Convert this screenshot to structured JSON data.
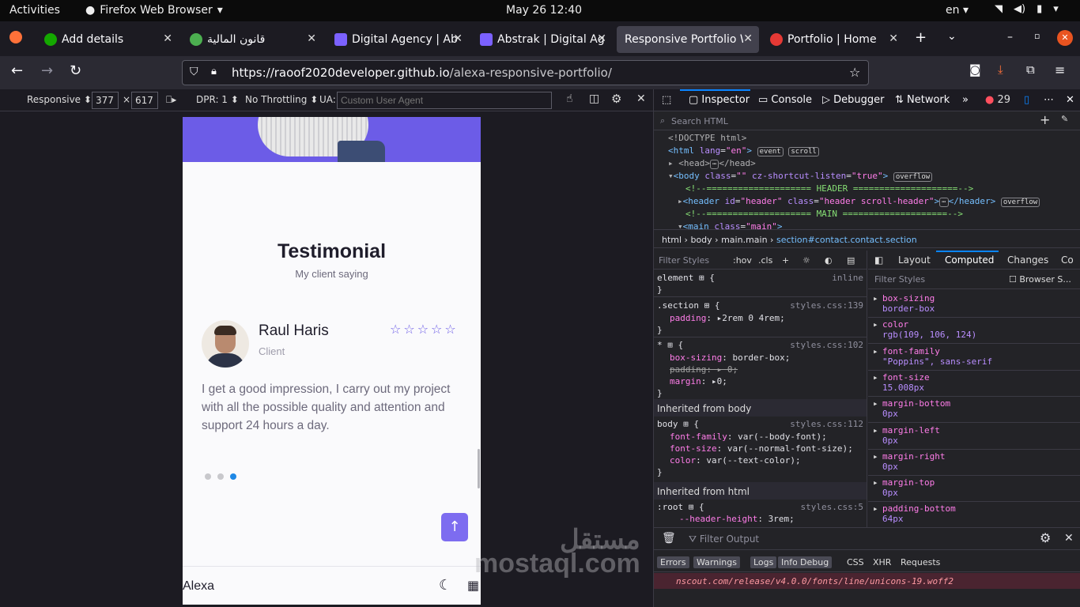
{
  "system": {
    "activities": "Activities",
    "app": "Firefox Web Browser",
    "clock": "May 26  12:40",
    "lang": "en"
  },
  "tabs": [
    {
      "title": "Add details",
      "color": "#14a800"
    },
    {
      "title": "قانون المالية",
      "color": "#4caf50"
    },
    {
      "title": "Digital Agency | Ab",
      "color": "#7b61ff"
    },
    {
      "title": "Abstrak | Digital Ag",
      "color": "#7b61ff"
    },
    {
      "title": "Responsive Portfolio W",
      "color": "#42414d"
    },
    {
      "title": "Portfolio | Home",
      "color": "#e53935"
    }
  ],
  "url": {
    "host": "https://raoof2020developer.github.io",
    "path": "/alexa-responsive-portfolio/"
  },
  "rdm": {
    "device": "Responsive",
    "width": "377",
    "height": "617",
    "dpr": "DPR: 1",
    "throttle": "No Throttling",
    "ua_label": "UA:",
    "ua_placeholder": "Custom User Agent"
  },
  "page": {
    "title": "Testimonial",
    "subtitle": "My client saying",
    "name": "Raul Haris",
    "role": "Client",
    "stars": "☆☆☆☆☆",
    "quote": "I get a good impression, I carry out my project with all the possible quality and attention and support 24 hours a day.",
    "logo": "Alexa"
  },
  "devtools": {
    "tabs": [
      "Inspector",
      "Console",
      "Debugger",
      "Network"
    ],
    "errors": "29",
    "search": "Search HTML",
    "breadcrumb": [
      "html",
      "body",
      "main.main",
      "section#contact.contact.section"
    ],
    "filter_styles": "Filter Styles",
    "hov": ":hov",
    "cls": ".cls",
    "comp_tabs": [
      "Layout",
      "Computed",
      "Changes",
      "Co"
    ],
    "browser_styles": "Browser S...",
    "inherited_body": "Inherited from body",
    "inherited_html": "Inherited from html",
    "computed": [
      {
        "name": "box-sizing",
        "value": "border-box"
      },
      {
        "name": "color",
        "value": "rgb(109, 106, 124)"
      },
      {
        "name": "font-family",
        "value": "\"Poppins\", sans-serif"
      },
      {
        "name": "font-size",
        "value": "15.008px"
      },
      {
        "name": "margin-bottom",
        "value": "0px"
      },
      {
        "name": "margin-left",
        "value": "0px"
      },
      {
        "name": "margin-right",
        "value": "0px"
      },
      {
        "name": "margin-top",
        "value": "0px"
      },
      {
        "name": "padding-bottom",
        "value": "64px"
      }
    ],
    "console": {
      "filter": "Filter Output",
      "buttons": [
        "Errors",
        "Warnings",
        "Logs",
        "Info",
        "Debug"
      ],
      "types": [
        "CSS",
        "XHR",
        "Requests"
      ],
      "error": "nscout.com/release/v4.0.0/fonts/line/unicons-19.woff2"
    }
  },
  "watermark": {
    "ar": "مستقل",
    "en": "mostaql.com"
  }
}
